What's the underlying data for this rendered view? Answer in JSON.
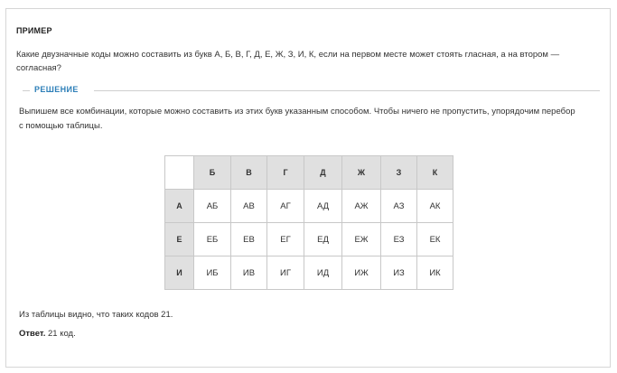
{
  "example": {
    "heading": "ПРИМЕР",
    "task": "Какие двузначные коды можно составить из букв  А, Б, В, Г, Д, Е, Ж, З, И, К, если на первом месте может стоять гласная, а на втором — согласная?"
  },
  "solution": {
    "label": "РЕШЕНИЕ",
    "intro": "Выпишем все комбинации, которые можно составить из этих букв указанным способом. Чтобы ничего не пропустить, упорядочим перебор с помощью таблицы."
  },
  "table": {
    "columns": [
      "Б",
      "В",
      "Г",
      "Д",
      "Ж",
      "З",
      "К"
    ],
    "rows": [
      {
        "head": "А",
        "cells": [
          "АБ",
          "АВ",
          "АГ",
          "АД",
          "АЖ",
          "АЗ",
          "АК"
        ]
      },
      {
        "head": "Е",
        "cells": [
          "ЕБ",
          "ЕВ",
          "ЕГ",
          "ЕД",
          "ЕЖ",
          "ЕЗ",
          "ЕК"
        ]
      },
      {
        "head": "И",
        "cells": [
          "ИБ",
          "ИВ",
          "ИГ",
          "ИД",
          "ИЖ",
          "ИЗ",
          "ИК"
        ]
      }
    ]
  },
  "conclusion": "Из таблицы видно, что таких кодов 21.",
  "answer": {
    "label": "Ответ.",
    "value": " 21 код."
  }
}
